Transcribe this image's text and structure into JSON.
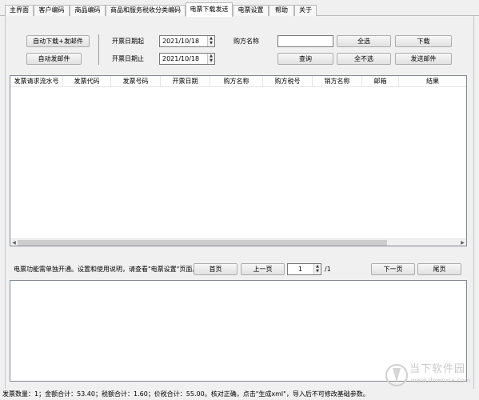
{
  "tabs": [
    {
      "label": "主界面"
    },
    {
      "label": "客户编码"
    },
    {
      "label": "商品编码"
    },
    {
      "label": "商品和服务税收分类编码"
    },
    {
      "label": "电票下载发送"
    },
    {
      "label": "电票设置"
    },
    {
      "label": "帮助"
    },
    {
      "label": "关于"
    }
  ],
  "active_tab": "电票下载发送",
  "controls": {
    "auto_download_email_label": "自动下载+发邮件",
    "auto_email_label": "自动发邮件",
    "start_date_label": "开票日期起",
    "start_date_value": "2021/10/18",
    "end_date_label": "开票日期止",
    "end_date_value": "2021/10/18",
    "buyer_name_label": "购方名称",
    "buyer_name_value": "",
    "select_all_label": "全选",
    "download_label": "下载",
    "query_label": "查询",
    "select_none_label": "全不选",
    "send_email_label": "发送邮件"
  },
  "table": {
    "columns": [
      "发票请求流水号",
      "发票代码",
      "发票号码",
      "开票日期",
      "购方名称",
      "购方税号",
      "销方名称",
      "邮箱",
      "结果"
    ],
    "rows": []
  },
  "pager": {
    "notice": "电票功能需单独开通。设置和使用说明，请查看\"电票设置\"页面。",
    "first_label": "首页",
    "prev_label": "上一页",
    "page_value": "1",
    "total_pages": "/1",
    "next_label": "下一页",
    "last_label": "尾页"
  },
  "statusbar": {
    "text": "发票数量：1；金额合计：53.40；税额合计：1.60；价税合计：55.00。核对正确，点击\"生成xml\"，导入后不可修改基础参数。"
  },
  "watermark": {
    "title": "当下软件园",
    "url": "www.downxia.com"
  },
  "colors": {
    "window_bg": "#f0f0f0",
    "border": "#828790",
    "watermark": "#c9c9c9"
  }
}
